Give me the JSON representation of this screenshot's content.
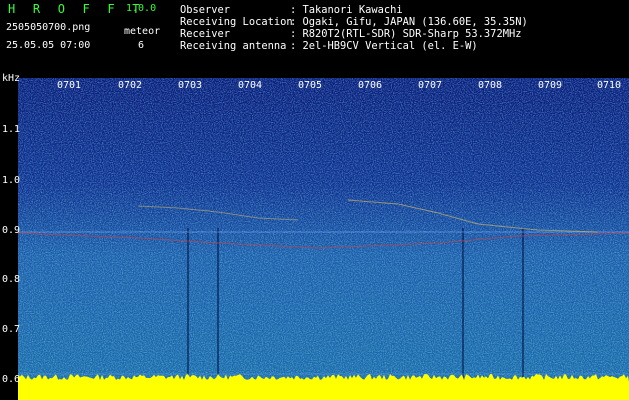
{
  "header": {
    "app_name": "H R O F F T",
    "app_version": "1.0.0",
    "file_name": "2505050700.png",
    "timestamp": "25.05.05 07:00",
    "meteor_label": "meteor",
    "meteor_count": "6"
  },
  "info": [
    {
      "key": "Observer",
      "value": ": Takanori Kawachi"
    },
    {
      "key": "Receiving Location",
      "value": ": Ogaki, Gifu, JAPAN (136.60E, 35.35N)"
    },
    {
      "key": "Receiver",
      "value": ": R820T2(RTL-SDR) SDR-Sharp 53.372MHz"
    },
    {
      "key": "Receiving antenna",
      "value": ": 2el-HB9CV Vertical (el. E-W)"
    }
  ],
  "axis": {
    "y_unit": "kHz",
    "y_labels": [
      "1.1",
      "1.0",
      "0.9",
      "0.8",
      "0.7",
      "0.6"
    ],
    "x_labels": [
      "0701",
      "0702",
      "0703",
      "0704",
      "0705",
      "0706",
      "0707",
      "0708",
      "0709",
      "0710"
    ]
  },
  "colors": {
    "header_green": "#33ff33",
    "baseline_yellow": "#ffff00",
    "background": "#0a1a7a"
  }
}
